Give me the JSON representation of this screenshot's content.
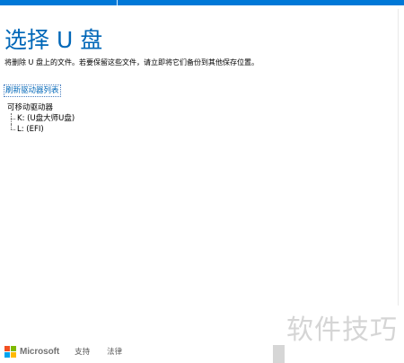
{
  "header": {
    "title": "选择 U 盘",
    "subtitle": "将删除 U 盘上的文件。若要保留这些文件，请立即将它们备份到其他保存位置。"
  },
  "refresh_link": "刷新驱动器列表",
  "drives": {
    "group_label": "可移动驱动器",
    "items": [
      {
        "label": "K: (U盘大师U盘)"
      },
      {
        "label": "L: (EFI)"
      }
    ]
  },
  "footer": {
    "brand": "Microsoft",
    "links": [
      "支持",
      "法律"
    ]
  },
  "watermark": "软件技巧",
  "colors": {
    "accent": "#0067b8",
    "top_bar": "#0078d7",
    "logo_red": "#f25022",
    "logo_green": "#7fba00",
    "logo_blue": "#00a4ef",
    "logo_yellow": "#ffb900"
  }
}
